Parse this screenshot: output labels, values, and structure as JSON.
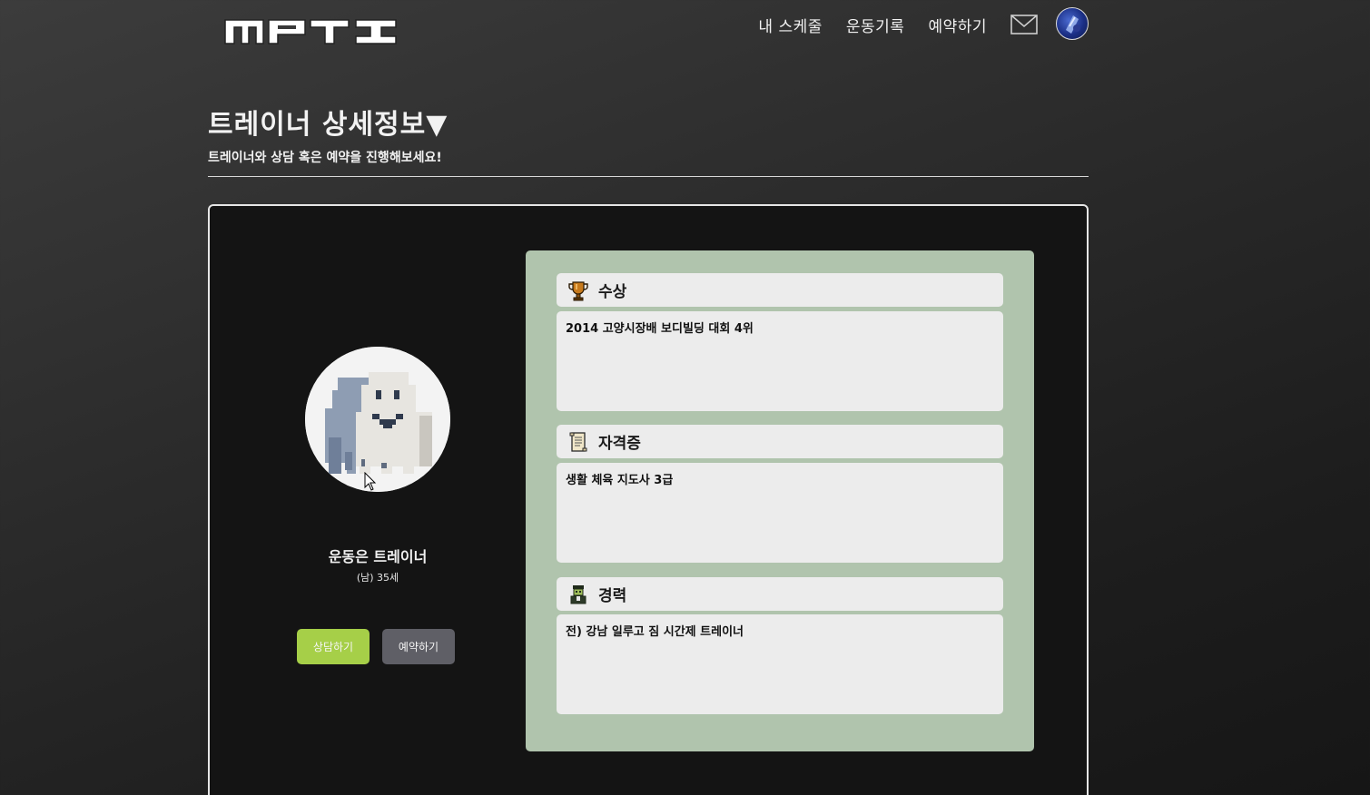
{
  "header": {
    "logo_text": "MPTI",
    "nav": [
      "내 스케줄",
      "운동기록",
      "예약하기"
    ]
  },
  "page": {
    "title": "트레이너 상세정보▼",
    "subtitle": "트레이너와 상담 혹은 예약을 진행해보세요!"
  },
  "trainer": {
    "name": "운동은 트레이너",
    "meta": "(남) 35세",
    "consult_label": "상담하기",
    "reserve_label": "예약하기"
  },
  "sections": {
    "award": {
      "title": "수상",
      "icon": "trophy-icon",
      "content": "2014 고양시장배 보디빌딩 대회 4위"
    },
    "certificate": {
      "title": "자격증",
      "icon": "scroll-icon",
      "content": "생활 체육 지도사 3급"
    },
    "career": {
      "title": "경력",
      "icon": "person-icon",
      "content": "전) 강남 일루고 짐 시간제 트레이너"
    }
  },
  "colors": {
    "consult_button": "#a6cf48",
    "reserve_button": "#5f5f66",
    "info_panel": "#b0c4ad"
  }
}
